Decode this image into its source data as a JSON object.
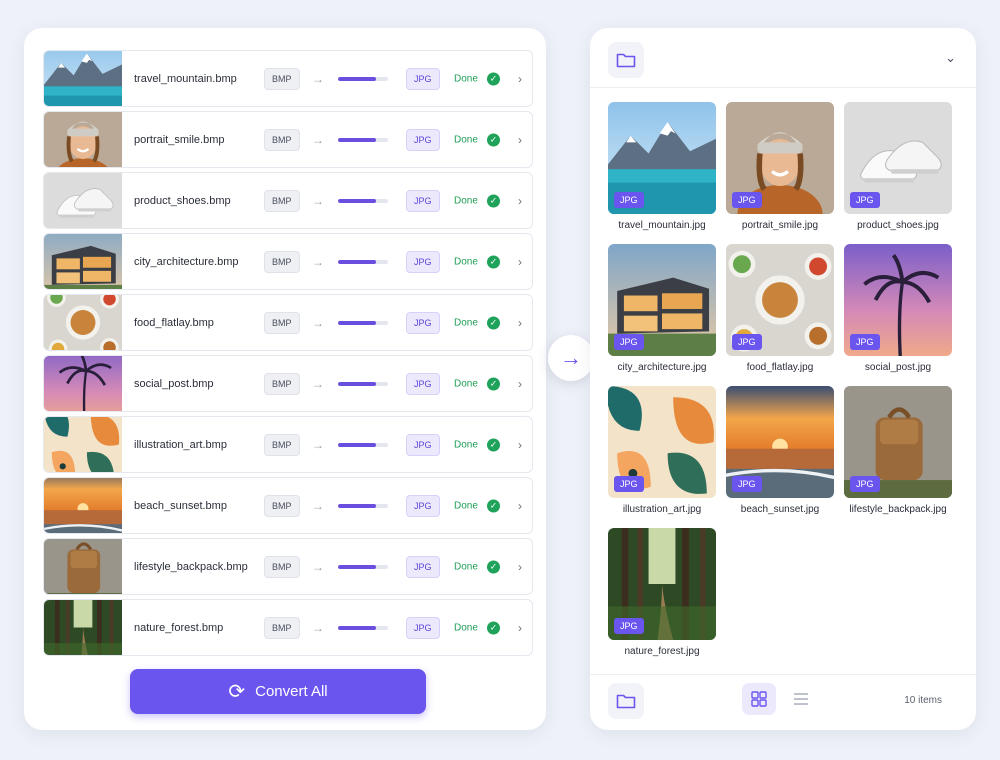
{
  "files": [
    {
      "name": "travel_mountain.bmp",
      "source_format": "BMP",
      "target_format": "JPG",
      "status": "Done",
      "progress": 0.75,
      "thumb": "mountain"
    },
    {
      "name": "portrait_smile.bmp",
      "source_format": "BMP",
      "target_format": "JPG",
      "status": "Done",
      "progress": 0.75,
      "thumb": "portrait"
    },
    {
      "name": "product_shoes.bmp",
      "source_format": "BMP",
      "target_format": "JPG",
      "status": "Done",
      "progress": 0.75,
      "thumb": "shoes"
    },
    {
      "name": "city_architecture.bmp",
      "source_format": "BMP",
      "target_format": "JPG",
      "status": "Done",
      "progress": 0.75,
      "thumb": "architecture"
    },
    {
      "name": "food_flatlay.bmp",
      "source_format": "BMP",
      "target_format": "JPG",
      "status": "Done",
      "progress": 0.75,
      "thumb": "food"
    },
    {
      "name": "social_post.bmp",
      "source_format": "BMP",
      "target_format": "JPG",
      "status": "Done",
      "progress": 0.75,
      "thumb": "palm"
    },
    {
      "name": "illustration_art.bmp",
      "source_format": "BMP",
      "target_format": "JPG",
      "status": "Done",
      "progress": 0.75,
      "thumb": "leaves"
    },
    {
      "name": "beach_sunset.bmp",
      "source_format": "BMP",
      "target_format": "JPG",
      "status": "Done",
      "progress": 0.75,
      "thumb": "sunset"
    },
    {
      "name": "lifestyle_backpack.bmp",
      "source_format": "BMP",
      "target_format": "JPG",
      "status": "Done",
      "progress": 0.75,
      "thumb": "backpack"
    },
    {
      "name": "nature_forest.bmp",
      "source_format": "BMP",
      "target_format": "JPG",
      "status": "Done",
      "progress": 0.75,
      "thumb": "forest"
    }
  ],
  "convert_button": {
    "label": "Convert All"
  },
  "output": {
    "files": [
      {
        "name": "travel_mountain.jpg",
        "badge": "JPG",
        "thumb": "mountain"
      },
      {
        "name": "portrait_smile.jpg",
        "badge": "JPG",
        "thumb": "portrait"
      },
      {
        "name": "product_shoes.jpg",
        "badge": "JPG",
        "thumb": "shoes"
      },
      {
        "name": "city_architecture.jpg",
        "badge": "JPG",
        "thumb": "architecture"
      },
      {
        "name": "food_flatlay.jpg",
        "badge": "JPG",
        "thumb": "food"
      },
      {
        "name": "social_post.jpg",
        "badge": "JPG",
        "thumb": "palm"
      },
      {
        "name": "illustration_art.jpg",
        "badge": "JPG",
        "thumb": "leaves"
      },
      {
        "name": "beach_sunset.jpg",
        "badge": "JPG",
        "thumb": "sunset"
      },
      {
        "name": "lifestyle_backpack.jpg",
        "badge": "JPG",
        "thumb": "backpack"
      },
      {
        "name": "nature_forest.jpg",
        "badge": "JPG",
        "thumb": "forest"
      }
    ],
    "item_count": "10 items"
  },
  "icons": {
    "folder": "folder-icon",
    "chevron_down": "chevron-down-icon",
    "arrow_right": "arrow-right-icon",
    "convert": "refresh-icon",
    "grid_view": "grid-view-icon",
    "list_view": "list-view-icon",
    "check": "check-circle-icon"
  },
  "colors": {
    "accent": "#6a55ef",
    "success": "#1fa25a",
    "target_badge_bg": "#ece9fd"
  }
}
